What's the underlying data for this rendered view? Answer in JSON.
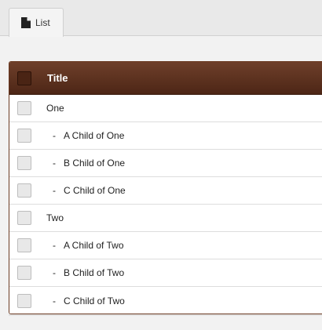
{
  "tabs": [
    {
      "label": "List",
      "icon": "document-icon"
    }
  ],
  "table": {
    "header": {
      "title": "Title"
    },
    "rows": [
      {
        "label": "One",
        "child": false
      },
      {
        "label": "A Child of One",
        "child": true
      },
      {
        "label": "B Child of One",
        "child": true
      },
      {
        "label": "C Child of One",
        "child": true
      },
      {
        "label": "Two",
        "child": false
      },
      {
        "label": "A Child of Two",
        "child": true
      },
      {
        "label": "B Child of Two",
        "child": true
      },
      {
        "label": "C Child of Two",
        "child": true
      }
    ],
    "child_prefix": "-"
  },
  "colors": {
    "header_top": "#6e3f2a",
    "header_bottom": "#4d2616"
  }
}
